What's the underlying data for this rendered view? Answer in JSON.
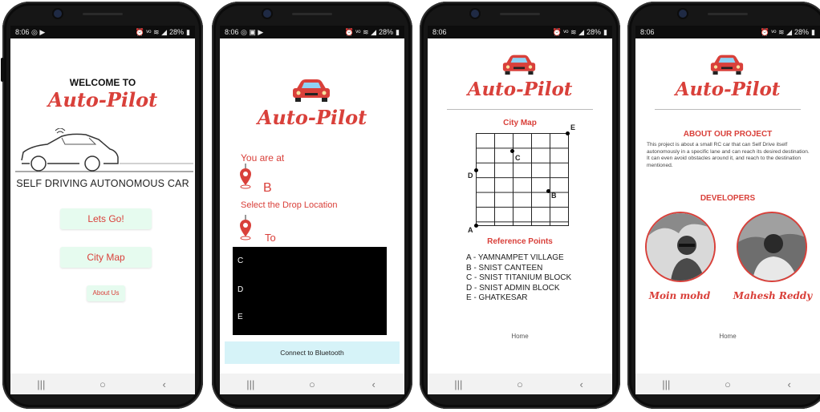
{
  "screens": [
    {
      "status": {
        "time": "8:06",
        "icons_left": "◎ ▶",
        "battery": "28%"
      },
      "title_line": "WELCOME TO",
      "logo": "Auto-Pilot",
      "subtitle": "SELF DRIVING AUTONOMOUS CAR",
      "buttons": [
        "Lets Go!",
        "City Map",
        "About Us"
      ]
    },
    {
      "status": {
        "time": "8:06",
        "icons_left": "◎ ▣ ▶",
        "battery": "28%"
      },
      "logo": "Auto-Pilot",
      "you_are_at": "You are at",
      "current_location": "B",
      "select_drop": "Select the Drop Location",
      "to_label": "To",
      "options": [
        "C",
        "D",
        "E"
      ],
      "connect_button": "Connect to Bluetooth"
    },
    {
      "status": {
        "time": "8:06",
        "battery": "28%"
      },
      "logo": "Auto-Pilot",
      "map_title": "City Map",
      "points": [
        "A",
        "B",
        "C",
        "D",
        "E"
      ],
      "ref_title": "Reference Points",
      "references": [
        "A - YAMNAMPET VILLAGE",
        "B - SNIST CANTEEN",
        "C - SNIST TITANIUM BLOCK",
        "D - SNIST ADMIN BLOCK",
        "E - GHATKESAR"
      ],
      "home_link": "Home"
    },
    {
      "status": {
        "time": "8:06",
        "battery": "28%"
      },
      "logo": "Auto-Pilot",
      "about_title": "ABOUT OUR PROJECT",
      "about_text": "This project is about a small RC car that can Self Drive itself autonomously in a specific lane and can reach its desired destination. It can even avoid obstacles around it, and reach to the destination mentioned.",
      "developers_title": "DEVELOPERS",
      "developers": [
        "Moin mohd",
        "Mahesh Reddy"
      ],
      "home_link": "Home"
    }
  ],
  "nav_icons": [
    "|||",
    "○",
    "‹"
  ],
  "colors": {
    "accent": "#d9403a",
    "mint": "#e6fbef",
    "bluetooth": "#d6f3f8"
  }
}
